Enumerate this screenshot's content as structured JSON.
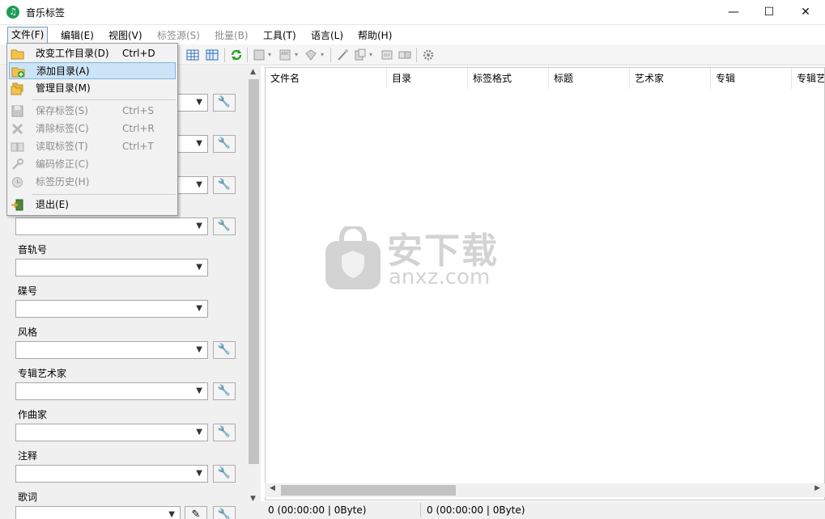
{
  "window": {
    "title": "音乐标签"
  },
  "menubar": [
    {
      "label": "文件(F)",
      "state": "open"
    },
    {
      "label": "编辑(E)",
      "state": "normal"
    },
    {
      "label": "视图(V)",
      "state": "normal"
    },
    {
      "label": "标签源(S)",
      "state": "disabled"
    },
    {
      "label": "批量(B)",
      "state": "disabled"
    },
    {
      "label": "工具(T)",
      "state": "normal"
    },
    {
      "label": "语言(L)",
      "state": "normal"
    },
    {
      "label": "帮助(H)",
      "state": "normal"
    }
  ],
  "file_menu": {
    "items": [
      {
        "label": "改变工作目录(D)",
        "shortcut": "Ctrl+D",
        "icon": "folder-icon",
        "state": "normal"
      },
      {
        "label": "添加目录(A)",
        "shortcut": "",
        "icon": "add-folder-icon",
        "state": "hover"
      },
      {
        "label": "管理目录(M)",
        "shortcut": "",
        "icon": "folders-icon",
        "state": "normal"
      },
      {
        "label": "保存标签(S)",
        "shortcut": "Ctrl+S",
        "icon": "save-icon",
        "state": "disabled"
      },
      {
        "label": "清除标签(C)",
        "shortcut": "Ctrl+R",
        "icon": "clear-icon",
        "state": "disabled"
      },
      {
        "label": "读取标签(T)",
        "shortcut": "Ctrl+T",
        "icon": "book-icon",
        "state": "disabled"
      },
      {
        "label": "编码修正(C)",
        "shortcut": "",
        "icon": "wrench-icon",
        "state": "disabled"
      },
      {
        "label": "标签历史(H)",
        "shortcut": "",
        "icon": "history-icon",
        "state": "disabled"
      },
      {
        "label": "退出(E)",
        "shortcut": "",
        "icon": "exit-icon",
        "state": "normal"
      }
    ]
  },
  "tag_fields": {
    "track_label": "音轨号",
    "disc_label": "碟号",
    "genre_label": "风格",
    "album_artist_label": "专辑艺术家",
    "composer_label": "作曲家",
    "comment_label": "注释",
    "lyrics_label": "歌词"
  },
  "file_list": {
    "columns": [
      "文件名",
      "目录",
      "标签格式",
      "标题",
      "艺术家",
      "专辑",
      "专辑艺"
    ]
  },
  "status": {
    "left": "0 (00:00:00 | 0Byte)",
    "right": "0 (00:00:00 | 0Byte)"
  },
  "watermark": {
    "big": "安下载",
    "small": "anxz.com"
  },
  "colors": {
    "app_icon": "#1a9e55",
    "menu_hover": "#cce4f7"
  }
}
